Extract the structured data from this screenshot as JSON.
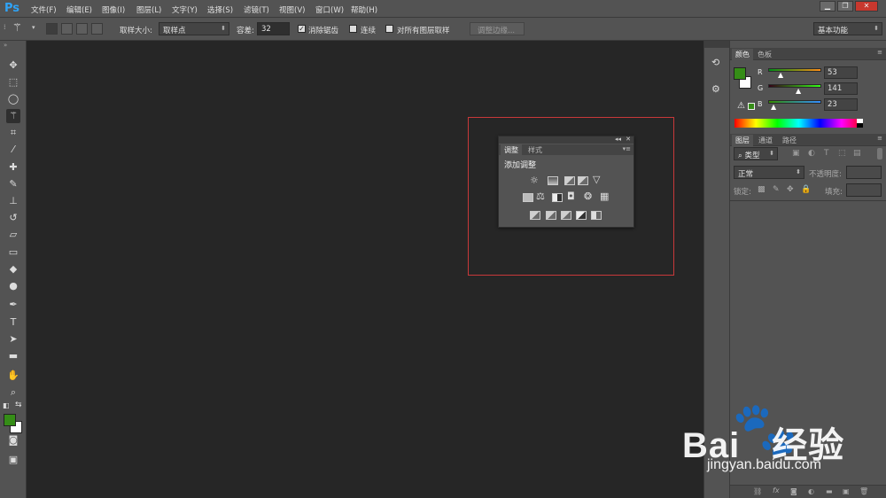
{
  "app": {
    "logo": "Ps"
  },
  "menu": [
    "文件(F)",
    "编辑(E)",
    "图像(I)",
    "图层(L)",
    "文字(Y)",
    "选择(S)",
    "滤镜(T)",
    "视图(V)",
    "窗口(W)",
    "帮助(H)"
  ],
  "window_controls": {
    "minimize": "▁",
    "restore": "❐",
    "close": "✕"
  },
  "options_bar": {
    "sample_size_label": "取样大小:",
    "sample_size_value": "取样点",
    "tolerance_label": "容差:",
    "tolerance_value": "32",
    "anti_alias_label": "消除锯齿",
    "anti_alias_checked": true,
    "contiguous_label": "连续",
    "contiguous_checked": false,
    "all_layers_label": "对所有图层取样",
    "all_layers_checked": false,
    "refine_edge_label": "调整边缘...",
    "workspace_value": "基本功能"
  },
  "tools": [
    "move-tool-icon",
    "marquee-tool-icon",
    "lasso-tool-icon",
    "magic-wand-tool-icon",
    "crop-tool-icon",
    "eyedropper-tool-icon",
    "healing-brush-tool-icon",
    "brush-tool-icon",
    "clone-stamp-tool-icon",
    "history-brush-tool-icon",
    "eraser-tool-icon",
    "gradient-tool-icon",
    "blur-tool-icon",
    "dodge-tool-icon",
    "pen-tool-icon",
    "type-tool-icon",
    "path-selection-tool-icon",
    "rectangle-tool-icon",
    "hand-tool-icon",
    "zoom-tool-icon"
  ],
  "colors": {
    "foreground": "#358d17",
    "background": "#ffffff",
    "highlight": "#c8383a"
  },
  "color_panel": {
    "tabs": [
      "颜色",
      "色板"
    ],
    "channels": [
      {
        "label": "R",
        "value": "53"
      },
      {
        "label": "G",
        "value": "141"
      },
      {
        "label": "B",
        "value": "23"
      }
    ]
  },
  "layers_panel": {
    "tabs": [
      "图层",
      "通道",
      "路径"
    ],
    "filter_label": "类型",
    "blend_mode": "正常",
    "opacity_label": "不透明度:",
    "lock_label": "锁定:",
    "fill_label": "填充:"
  },
  "adjustments_panel": {
    "tabs": [
      "调整",
      "样式"
    ],
    "title": "添加调整",
    "rows": [
      [
        "brightness-icon",
        "levels-icon",
        "curves-icon",
        "exposure-icon",
        "vibrance-icon"
      ],
      [
        "hue-saturation-icon",
        "color-balance-icon",
        "black-white-icon",
        "photo-filter-icon",
        "channel-mixer-icon",
        "color-lookup-icon"
      ],
      [
        "invert-icon",
        "posterize-icon",
        "threshold-icon",
        "gradient-map-icon",
        "selective-color-icon"
      ]
    ]
  },
  "watermark": {
    "brand": "Bai",
    "brand2": "经验",
    "url": "jingyan.baidu.com"
  }
}
